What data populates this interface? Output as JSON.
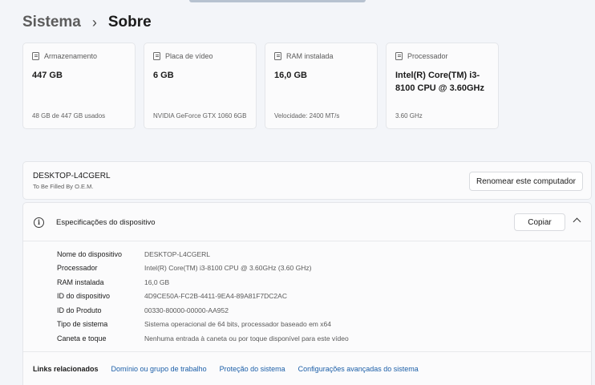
{
  "breadcrumb": {
    "parent": "Sistema",
    "separator": "›",
    "current": "Sobre"
  },
  "cards": [
    {
      "label": "Armazenamento",
      "value": "447 GB",
      "sub": "48 GB de 447 GB usados"
    },
    {
      "label": "Placa de vídeo",
      "value": "6 GB",
      "sub": "NVIDIA GeForce GTX 1060 6GB"
    },
    {
      "label": "RAM instalada",
      "value": "16,0 GB",
      "sub": "Velocidade: 2400 MT/s"
    },
    {
      "label": "Processador",
      "value": "Intel(R) Core(TM) i3-8100 CPU @ 3.60GHz",
      "sub": "3.60 GHz"
    }
  ],
  "device": {
    "name": "DESKTOP-L4CGERL",
    "maker": "To Be Filled By O.E.M.",
    "rename_label": "Renomear este computador"
  },
  "specs": {
    "info_icon": "i",
    "title": "Especificações do dispositivo",
    "copy_label": "Copiar",
    "rows": [
      {
        "key": "Nome do dispositivo",
        "value": "DESKTOP-L4CGERL"
      },
      {
        "key": "Processador",
        "value": "Intel(R) Core(TM) i3-8100 CPU @ 3.60GHz (3.60 GHz)"
      },
      {
        "key": "RAM instalada",
        "value": "16,0 GB"
      },
      {
        "key": "ID do dispositivo",
        "value": "4D9CE50A-FC2B-4411-9EA4-89A81F7DC2AC"
      },
      {
        "key": "ID do Produto",
        "value": "00330-80000-00000-AA952"
      },
      {
        "key": "Tipo de sistema",
        "value": "Sistema operacional de 64 bits, processador baseado em x64"
      },
      {
        "key": "Caneta e toque",
        "value": "Nenhuma entrada à caneta ou por toque disponível para este vídeo"
      }
    ]
  },
  "links": {
    "label": "Links relacionados",
    "items": [
      "Domínio ou grupo de trabalho",
      "Proteção do sistema",
      "Configurações avançadas do sistema"
    ]
  }
}
